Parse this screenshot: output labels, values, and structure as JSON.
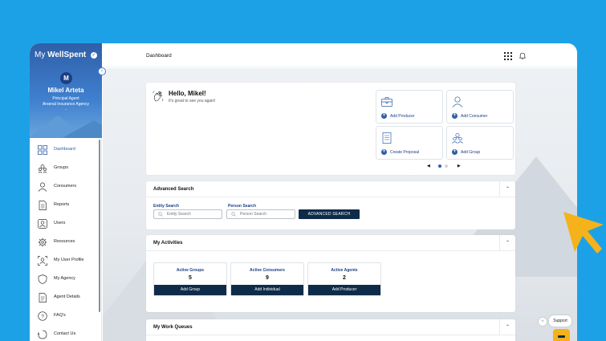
{
  "brand": {
    "prefix": "My ",
    "name": "WellSpent"
  },
  "agent": {
    "initial": "M",
    "name": "Mikel Arteta",
    "role": "Principal Agent",
    "agency": "Arsenal Insurance Agency",
    "extra": "-"
  },
  "sidebar": {
    "items": [
      {
        "label": "Dashboard",
        "icon": "dashboard-icon",
        "active": true
      },
      {
        "label": "Groups",
        "icon": "groups-icon"
      },
      {
        "label": "Consumers",
        "icon": "consumer-icon"
      },
      {
        "label": "Reports",
        "icon": "reports-icon"
      },
      {
        "label": "Users",
        "icon": "users-icon"
      },
      {
        "label": "Resources",
        "icon": "resources-icon"
      },
      {
        "label": "My User Profile",
        "icon": "user-profile-icon"
      },
      {
        "label": "My Agency",
        "icon": "agency-icon"
      },
      {
        "label": "Agent Details",
        "icon": "agent-details-icon"
      },
      {
        "label": "FAQ's",
        "icon": "faq-icon"
      },
      {
        "label": "Contact Us",
        "icon": "contact-icon"
      }
    ]
  },
  "topbar": {
    "title": "Dashboard"
  },
  "welcome": {
    "title": "Hello, Mikel!",
    "subtitle": "It's great to see you again!"
  },
  "quick_actions": [
    {
      "label": "Add Producer",
      "icon": "briefcase-icon"
    },
    {
      "label": "Add Consumer",
      "icon": "person-icon"
    },
    {
      "label": "Create Proposal",
      "icon": "document-icon"
    },
    {
      "label": "Add Group",
      "icon": "group-icon"
    }
  ],
  "advanced_search": {
    "title": "Advanced Search",
    "entity_label": "Entity Search",
    "entity_placeholder": "Entity Search",
    "person_label": "Person Search",
    "person_placeholder": "Person Search",
    "button": "ADVANCED SEARCH"
  },
  "activities": {
    "title": "My Activities",
    "stats": [
      {
        "title": "Active Groups",
        "value": "5",
        "button": "Add Group"
      },
      {
        "title": "Active Consumers",
        "value": "9",
        "button": "Add Individual"
      },
      {
        "title": "Active Agents",
        "value": "2",
        "button": "Add Producer"
      }
    ]
  },
  "work_queues": {
    "title": "My Work Queues"
  },
  "support": {
    "label": "Support"
  },
  "colors": {
    "background": "#1da1e6",
    "navy": "#0e2c4a",
    "accent": "#2f5fa8",
    "cursor": "#f5b21a"
  }
}
